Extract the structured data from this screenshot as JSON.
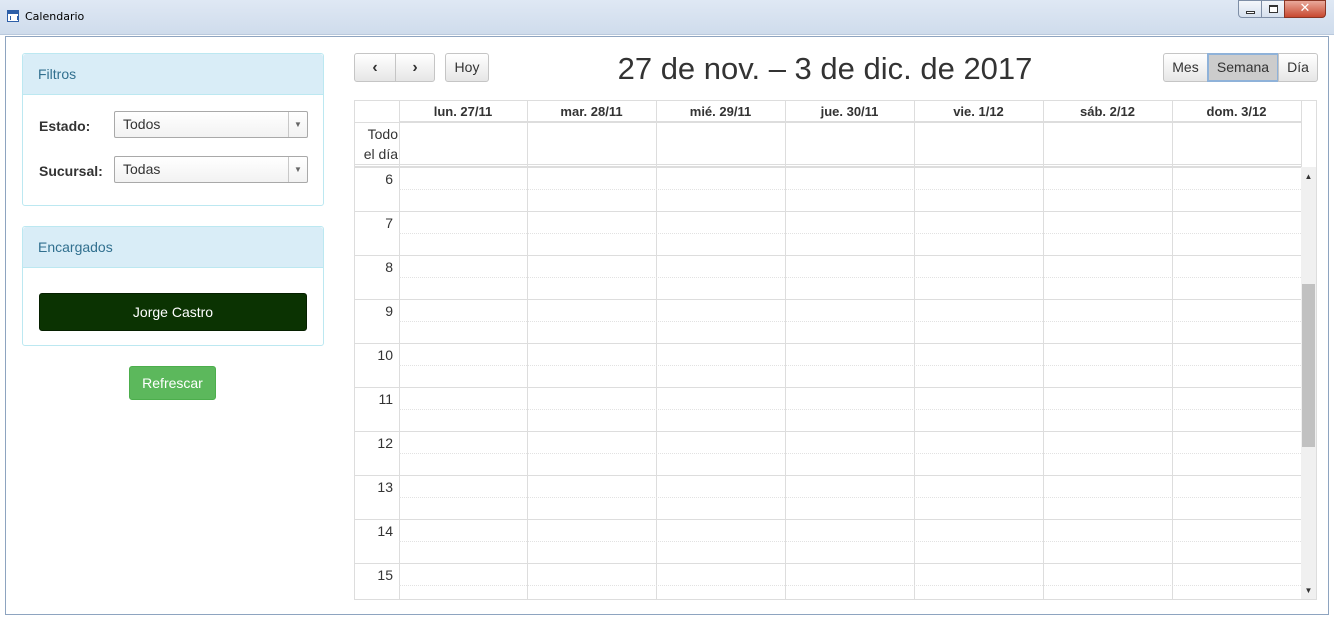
{
  "window": {
    "title": "Calendario",
    "controls": {
      "minimize": "minimize",
      "maximize": "maximize",
      "close": "✕"
    }
  },
  "filters": {
    "heading": "Filtros",
    "estado_label": "Estado:",
    "estado_value": "Todos",
    "sucursal_label": "Sucursal:",
    "sucursal_value": "Todas"
  },
  "managers": {
    "heading": "Encargados",
    "items": [
      {
        "name": "Jorge Castro",
        "color": "#0b3302"
      }
    ]
  },
  "refresh_label": "Refrescar",
  "calendar": {
    "title": "27 de nov. – 3 de dic. de 2017",
    "nav": {
      "prev": "‹",
      "next": "›",
      "today": "Hoy"
    },
    "views": {
      "month": "Mes",
      "week": "Semana",
      "day": "Día",
      "active": "week"
    },
    "days": [
      "lun. 27/11",
      "mar. 28/11",
      "mié. 29/11",
      "jue. 30/11",
      "vie. 1/12",
      "sáb. 2/12",
      "dom. 3/12"
    ],
    "allday_label_1": "Todo",
    "allday_label_2": "el día",
    "hours": [
      "6",
      "7",
      "8",
      "9",
      "10",
      "11",
      "12",
      "13",
      "14",
      "15"
    ]
  },
  "colors": {
    "panel_heading_bg": "#d9edf7",
    "panel_heading_text": "#31708f",
    "refresh_button": "#5cb85c",
    "manager_button": "#0b3302"
  }
}
